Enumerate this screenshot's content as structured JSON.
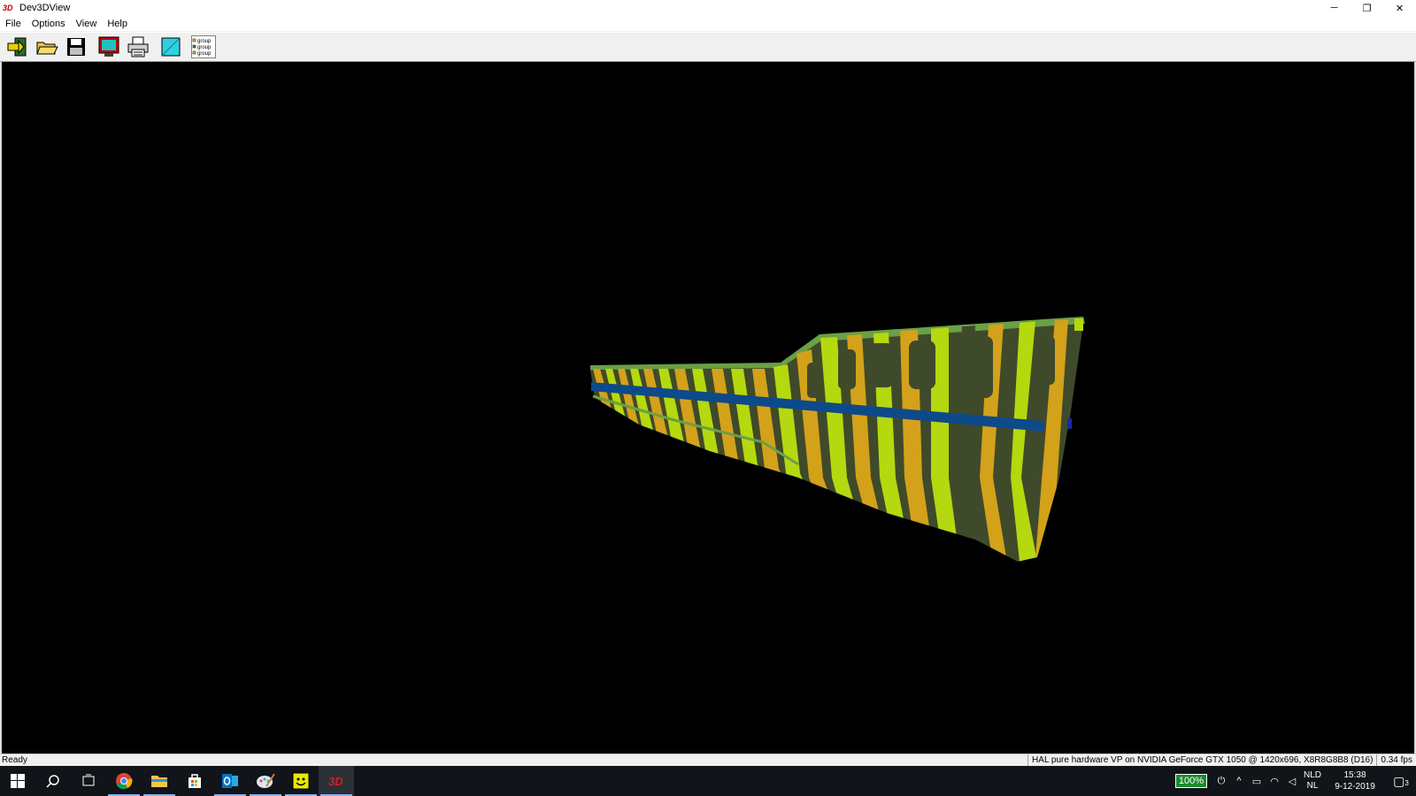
{
  "window": {
    "app_icon": "3D",
    "title": "Dev3DView",
    "minimize": "─",
    "restore": "❐",
    "close": "✕"
  },
  "menu": [
    "File",
    "Options",
    "View",
    "Help"
  ],
  "toolbar": {
    "buttons": [
      "exit-icon",
      "open-folder-icon",
      "save-disk-icon",
      "monitor-icon",
      "printer-icon",
      "color-square-icon",
      "group-list-icon"
    ],
    "group_lines": [
      "group",
      "group",
      "group"
    ]
  },
  "viewport": {
    "background": "#000000",
    "model": "ship-hull",
    "colors": {
      "frame_yellow": "#b5d80f",
      "frame_orange": "#d4a11a",
      "plate": "#3f4a2a",
      "deck": "#6aa046",
      "stringer": "#0d4a8a"
    }
  },
  "status": {
    "left": "Ready",
    "right": "HAL pure hardware VP on NVIDIA GeForce GTX 1050 @ 1420x696, X8R8G8B8 (D16)",
    "fps": "0.34 fps"
  },
  "taskbar": {
    "items": [
      "windows-start-icon",
      "search-icon",
      "task-view-icon",
      "chrome-icon",
      "file-explorer-icon",
      "store-icon",
      "outlook-icon",
      "paint-icon",
      "smiley-app-icon",
      "dev3dview-icon"
    ],
    "battery": "100%",
    "lang_top": "NLD",
    "lang_bottom": "NL",
    "time": "15:38",
    "date": "9-12-2019",
    "notifications": "3"
  }
}
